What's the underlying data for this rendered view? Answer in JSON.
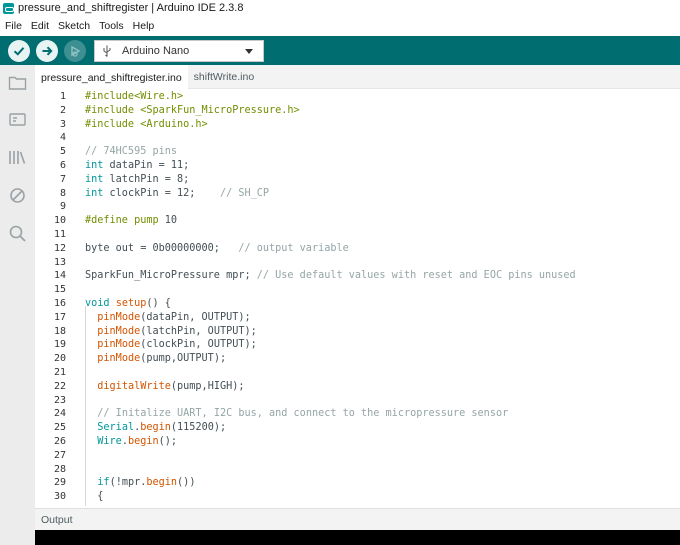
{
  "window": {
    "title": "pressure_and_shiftregister | Arduino IDE 2.3.8"
  },
  "menu": [
    "File",
    "Edit",
    "Sketch",
    "Tools",
    "Help"
  ],
  "toolbar": {
    "verify_icon": "check-icon",
    "upload_icon": "arrow-right-icon",
    "debug_icon": "debug-icon",
    "board": "Arduino Nano"
  },
  "sidebar": [
    "folder-icon",
    "board-manager-icon",
    "library-icon",
    "debug-stop-icon",
    "search-icon"
  ],
  "tabs": [
    {
      "label": "pressure_and_shiftregister.ino",
      "active": true
    },
    {
      "label": "shiftWrite.ino",
      "active": false
    }
  ],
  "code": [
    {
      "n": "1",
      "t": [
        [
          "pp",
          "#include<Wire.h>"
        ]
      ]
    },
    {
      "n": "2",
      "t": [
        [
          "pp",
          "#include <SparkFun_MicroPressure.h>"
        ]
      ]
    },
    {
      "n": "3",
      "t": [
        [
          "pp",
          "#include <Arduino.h>"
        ]
      ]
    },
    {
      "n": "4",
      "t": []
    },
    {
      "n": "5",
      "t": [
        [
          "cm",
          "// 74HC595 pins"
        ]
      ]
    },
    {
      "n": "6",
      "t": [
        [
          "kw",
          "int"
        ],
        [
          "tx",
          " dataPin = 11;"
        ]
      ]
    },
    {
      "n": "7",
      "t": [
        [
          "kw",
          "int"
        ],
        [
          "tx",
          " latchPin = 8;"
        ]
      ]
    },
    {
      "n": "8",
      "t": [
        [
          "kw",
          "int"
        ],
        [
          "tx",
          " clockPin = 12;    "
        ],
        [
          "cm",
          "// SH_CP"
        ]
      ]
    },
    {
      "n": "9",
      "t": []
    },
    {
      "n": "10",
      "t": [
        [
          "pp",
          "#define"
        ],
        [
          "tx",
          " "
        ],
        [
          "pp",
          "pump"
        ],
        [
          "tx",
          " 10"
        ]
      ]
    },
    {
      "n": "11",
      "t": []
    },
    {
      "n": "12",
      "t": [
        [
          "tx",
          "byte out = 0b00000000;   "
        ],
        [
          "cm",
          "// output variable"
        ]
      ]
    },
    {
      "n": "13",
      "t": []
    },
    {
      "n": "14",
      "t": [
        [
          "tx",
          "SparkFun_MicroPressure mpr; "
        ],
        [
          "cm",
          "// Use default values with reset and EOC pins unused"
        ]
      ]
    },
    {
      "n": "15",
      "t": []
    },
    {
      "n": "16",
      "t": [
        [
          "kw",
          "void"
        ],
        [
          "tx",
          " "
        ],
        [
          "fn",
          "setup"
        ],
        [
          "tx",
          "() {"
        ]
      ]
    },
    {
      "n": "17",
      "t": [
        [
          "tx",
          "  "
        ],
        [
          "fn",
          "pinMode"
        ],
        [
          "tx",
          "(dataPin, OUTPUT);"
        ]
      ]
    },
    {
      "n": "18",
      "t": [
        [
          "tx",
          "  "
        ],
        [
          "fn",
          "pinMode"
        ],
        [
          "tx",
          "(latchPin, OUTPUT);"
        ]
      ]
    },
    {
      "n": "19",
      "t": [
        [
          "tx",
          "  "
        ],
        [
          "fn",
          "pinMode"
        ],
        [
          "tx",
          "(clockPin, OUTPUT);"
        ]
      ]
    },
    {
      "n": "20",
      "t": [
        [
          "tx",
          "  "
        ],
        [
          "fn",
          "pinMode"
        ],
        [
          "tx",
          "(pump,OUTPUT);"
        ]
      ]
    },
    {
      "n": "21",
      "t": []
    },
    {
      "n": "22",
      "t": [
        [
          "tx",
          "  "
        ],
        [
          "fn",
          "digitalWrite"
        ],
        [
          "tx",
          "(pump,HIGH);"
        ]
      ]
    },
    {
      "n": "23",
      "t": []
    },
    {
      "n": "24",
      "t": [
        [
          "tx",
          "  "
        ],
        [
          "cm",
          "// Initalize UART, I2C bus, and connect to the micropressure sensor"
        ]
      ]
    },
    {
      "n": "25",
      "t": [
        [
          "tx",
          "  "
        ],
        [
          "kw",
          "Serial"
        ],
        [
          "tx",
          "."
        ],
        [
          "fn",
          "begin"
        ],
        [
          "tx",
          "(115200);"
        ]
      ]
    },
    {
      "n": "26",
      "t": [
        [
          "tx",
          "  "
        ],
        [
          "kw",
          "Wire"
        ],
        [
          "tx",
          "."
        ],
        [
          "fn",
          "begin"
        ],
        [
          "tx",
          "();"
        ]
      ]
    },
    {
      "n": "27",
      "t": []
    },
    {
      "n": "28",
      "t": []
    },
    {
      "n": "29",
      "t": [
        [
          "tx",
          "  "
        ],
        [
          "kw",
          "if"
        ],
        [
          "tx",
          "(!mpr."
        ],
        [
          "fn",
          "begin"
        ],
        [
          "tx",
          "())"
        ]
      ]
    },
    {
      "n": "30",
      "t": [
        [
          "tx",
          "  {"
        ]
      ]
    }
  ],
  "panel": {
    "output_label": "Output"
  },
  "colors": {
    "toolbar": "#006d70",
    "keyword": "#00979d",
    "function": "#d35400",
    "comment": "#95a5a6",
    "preprocessor": "#728e00"
  }
}
